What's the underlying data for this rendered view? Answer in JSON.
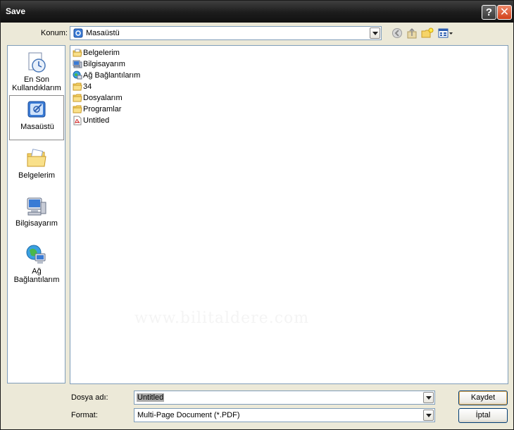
{
  "window": {
    "title": "Save"
  },
  "titlebar": {
    "help_glyph": "?",
    "close_glyph": "✕"
  },
  "lookin": {
    "label": "Konum:",
    "value": "Masaüstü"
  },
  "toolbar": {
    "icons": [
      "back-icon",
      "up-folder-icon",
      "new-folder-icon",
      "view-menu-icon"
    ]
  },
  "places": [
    {
      "line1": "En Son",
      "line2": "Kullandıklarım"
    },
    {
      "line1": "Masaüstü",
      "line2": ""
    },
    {
      "line1": "Belgelerim",
      "line2": ""
    },
    {
      "line1": "Bilgisayarım",
      "line2": ""
    },
    {
      "line1": "Ağ Bağlantılarım",
      "line2": ""
    }
  ],
  "files": [
    {
      "name": "Belgelerim"
    },
    {
      "name": "Bilgisayarım"
    },
    {
      "name": "Ağ Bağlantılarım"
    },
    {
      "name": "34"
    },
    {
      "name": "Dosyalarım"
    },
    {
      "name": "Programlar"
    },
    {
      "name": "Untitled"
    }
  ],
  "watermark": "www.bilitaldere.com",
  "filename": {
    "label": "Dosya adı:",
    "value": "Untitled"
  },
  "format": {
    "label": "Format:",
    "value": "Multi-Page Document (*.PDF)"
  },
  "buttons": {
    "save": "Kaydet",
    "cancel": "İptal"
  },
  "colors": {
    "titlebar": "#1c1c1c",
    "dialog_bg": "#ece9d8",
    "field_border": "#7f9db9",
    "button_border": "#003c74"
  }
}
